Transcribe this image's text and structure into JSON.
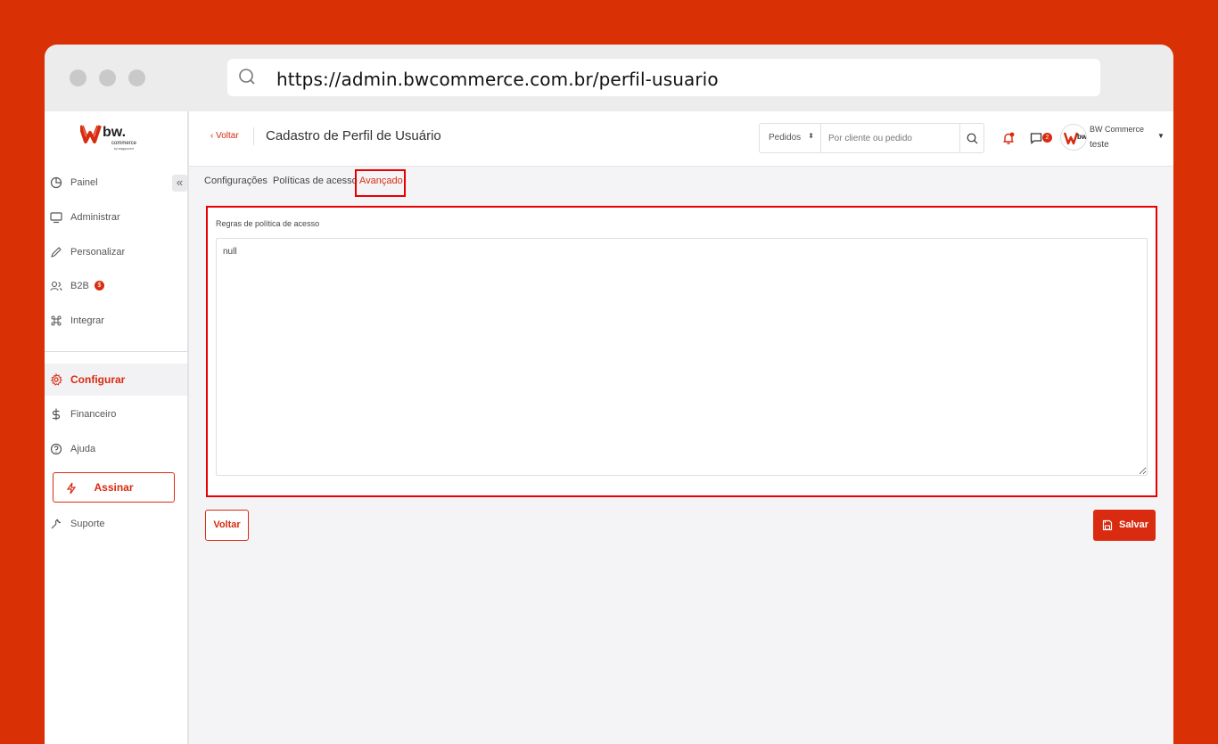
{
  "browser": {
    "url": "https://admin.bwcommerce.com.br/perfil-usuario"
  },
  "brand": {
    "logo_text": "bw.",
    "logo_sub": "commerce",
    "logo_tagline": "by wagrpozed",
    "accent_color": "#d92b10"
  },
  "sidebar": {
    "collapse_label": "«",
    "items": [
      {
        "label": "Painel",
        "icon": "clock-icon"
      },
      {
        "label": "Administrar",
        "icon": "monitor-icon"
      },
      {
        "label": "Personalizar",
        "icon": "pencil-icon"
      },
      {
        "label": "B2B",
        "icon": "users-icon",
        "badge": "$"
      },
      {
        "label": "Integrar",
        "icon": "command-icon"
      },
      {
        "label": "Configurar",
        "icon": "gear-icon",
        "active": true
      },
      {
        "label": "Financeiro",
        "icon": "dollar-icon"
      },
      {
        "label": "Ajuda",
        "icon": "help-icon"
      },
      {
        "label": "Suporte",
        "icon": "wrench-icon"
      }
    ],
    "subscribe_label": "Assinar"
  },
  "topbar": {
    "back_label": "‹ Voltar",
    "page_title": "Cadastro de Perfil de Usuário",
    "search_select": "Pedidos",
    "search_placeholder": "Por cliente ou pedido",
    "chat_badge": "2",
    "user_name": "BW Commerce",
    "user_sub": "teste"
  },
  "tabs": [
    {
      "label": "Configurações",
      "active": false
    },
    {
      "label": "Políticas de acesso",
      "active": false
    },
    {
      "label": "Avançado",
      "active": true
    }
  ],
  "form": {
    "field_label": "Regras de política de acesso",
    "field_value": "null"
  },
  "actions": {
    "back_label": "Voltar",
    "save_label": "Salvar"
  }
}
